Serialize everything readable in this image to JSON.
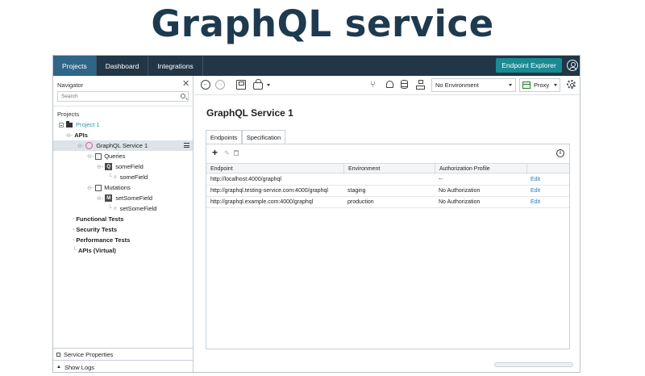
{
  "headline": "GraphQL service",
  "topbar": {
    "tabs": [
      "Projects",
      "Dashboard",
      "Integrations"
    ],
    "endpoint_explorer": "Endpoint Explorer"
  },
  "navigator": {
    "title": "Navigator",
    "search_placeholder": "Search",
    "projects_label": "Projects",
    "tree": {
      "project": "Project 1",
      "apis": "APIs",
      "service": "GraphQL Service 1",
      "queries": "Queries",
      "query_op": "someField",
      "query_field": "someField",
      "mutations": "Mutations",
      "mutation_op": "setSomeField",
      "mutation_field": "setSomeField",
      "functional_tests": "Functional Tests",
      "security_tests": "Security Tests",
      "performance_tests": "Performance Tests",
      "apis_virtual": "APIs (Virtual)"
    },
    "service_properties": "Service Properties",
    "show_logs": "Show Logs"
  },
  "toolbar": {
    "environment": "No Environment",
    "proxy": "Proxy"
  },
  "main": {
    "title": "GraphQL Service 1",
    "tabs": [
      "Endpoints",
      "Specification"
    ],
    "grid": {
      "headers": [
        "Endpoint",
        "Environment",
        "Authorization Profile"
      ],
      "rows": [
        {
          "endpoint": "http://localhost:4000/graphql",
          "environment": "",
          "auth": "--",
          "action": "Edit"
        },
        {
          "endpoint": "http://graphql.testing-service.com:4000/graphql",
          "environment": "staging",
          "auth": "No Authorization",
          "action": "Edit"
        },
        {
          "endpoint": "http://graphql.example.com:4000/graphql",
          "environment": "production",
          "auth": "No Authorization",
          "action": "Edit"
        }
      ]
    }
  },
  "colors": {
    "topbar": "#213647",
    "topbar_active": "#2f6586",
    "accent": "#1a8a93",
    "project_link": "#2a9d9d",
    "graphql_pink": "#d45aa7",
    "headline": "#1d3a4f"
  }
}
